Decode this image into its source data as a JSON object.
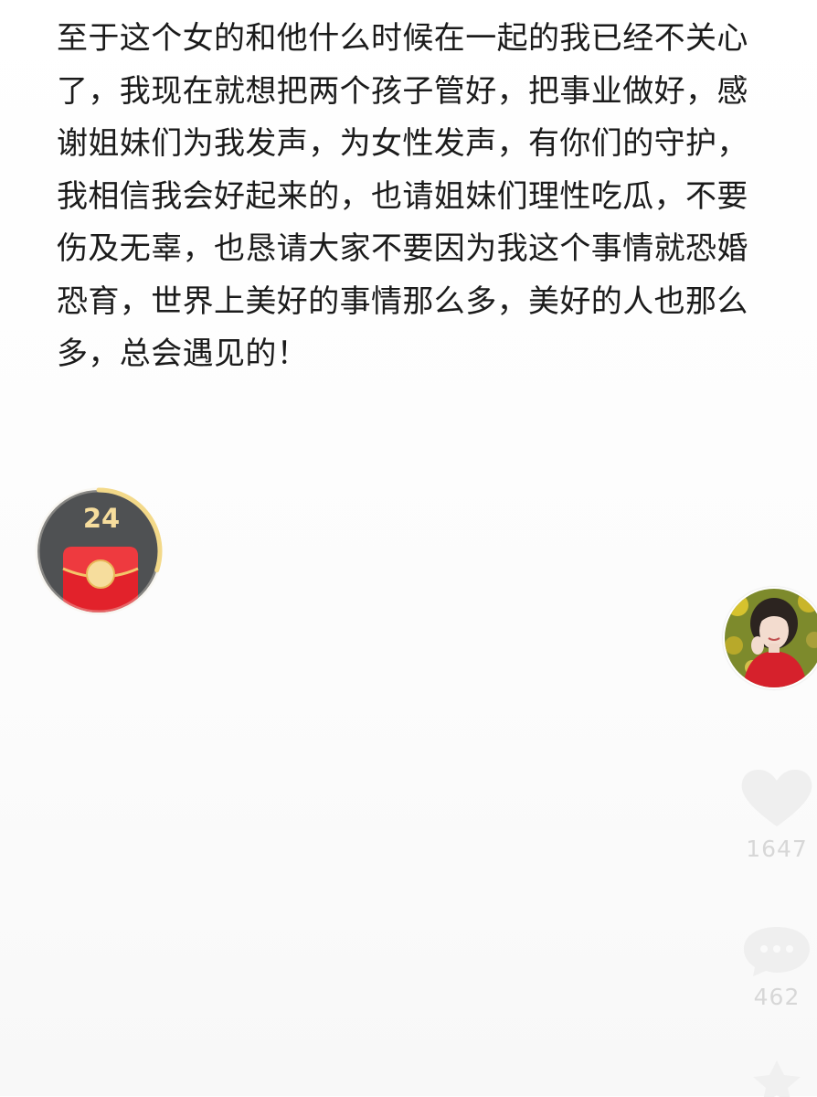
{
  "post": {
    "lines": [
      "至于这个女的和他什么时候在一起的我已经不关心",
      "了，我现在就想把两个孩子管好，把事业做好，感",
      "谢姐妹们为我发声，为女性发声，有你们的守护，",
      "我相信我会好起来的，也请姐妹们理性吃瓜，不要",
      "伤及无辜，也恳请大家不要因为我这个事情就恐婚",
      "恐育，世界上美好的事情那么多，美好的人也那么",
      "多，总会遇见的！"
    ]
  },
  "red_envelope": {
    "count": "24",
    "icon": "red-envelope-icon",
    "ring_progress": 0.3
  },
  "author": {
    "avatar_icon": "author-avatar"
  },
  "actions": {
    "like": {
      "icon": "heart-icon",
      "count": "1647"
    },
    "comment": {
      "icon": "comment-icon",
      "count": "462"
    },
    "favorite": {
      "icon": "star-icon"
    }
  },
  "colors": {
    "text": "#1b1b1b",
    "envelope_red": "#e2222b",
    "envelope_gold": "#f6dd9d",
    "widget_bg": "#4f5153",
    "faded_icon": "#ececec",
    "faded_count": "#d7d7d7"
  }
}
